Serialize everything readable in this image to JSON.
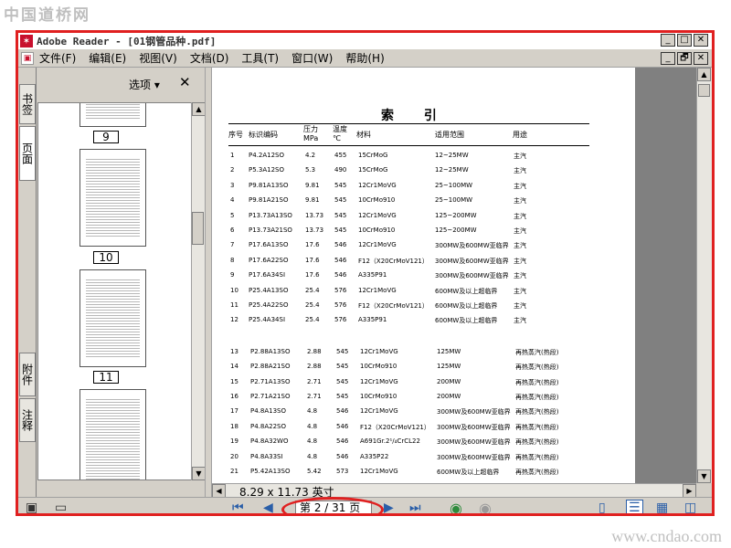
{
  "watermark_top": "中国道桥网",
  "watermark_bottom": "www.cndao.com",
  "window": {
    "title": "Adobe Reader - [01钢管品种.pdf]",
    "min": "_",
    "max": "□",
    "close": "✕",
    "restore": "🗗"
  },
  "menu": [
    "文件(F)",
    "编辑(E)",
    "视图(V)",
    "文档(D)",
    "工具(T)",
    "窗口(W)",
    "帮助(H)"
  ],
  "side_tabs": {
    "bookmarks": "书签",
    "pages": "页面",
    "attachments": "附件",
    "comments": "注释"
  },
  "thumbnails": {
    "options_label": "选项 ▾",
    "close": "✕",
    "labels": [
      "9",
      "10",
      "11"
    ]
  },
  "document": {
    "title": "索 引",
    "headers": {
      "no": "序号",
      "code": "标识编码",
      "pressure": "压力\nMPa",
      "temp": "温度\n℃",
      "material": "材料",
      "range": "适用范围",
      "use": "用途"
    },
    "rows": [
      [
        "1",
        "P4.2A12SO",
        "4.2",
        "455",
        "15CrMoG",
        "12~25MW",
        "主汽"
      ],
      [
        "2",
        "P5.3A12SO",
        "5.3",
        "490",
        "15CrMoG",
        "12~25MW",
        "主汽"
      ],
      [
        "3",
        "P9.81A13SO",
        "9.81",
        "545",
        "12Cr1MoVG",
        "25~100MW",
        "主汽"
      ],
      [
        "4",
        "P9.81A21SO",
        "9.81",
        "545",
        "10CrMo910",
        "25~100MW",
        "主汽"
      ],
      [
        "5",
        "P13.73A13SO",
        "13.73",
        "545",
        "12Cr1MoVG",
        "125~200MW",
        "主汽"
      ],
      [
        "6",
        "P13.73A21SO",
        "13.73",
        "545",
        "10CrMo910",
        "125~200MW",
        "主汽"
      ],
      [
        "7",
        "P17.6A13SO",
        "17.6",
        "546",
        "12Cr1MoVG",
        "300MW及600MW亚临界",
        "主汽"
      ],
      [
        "8",
        "P17.6A22SO",
        "17.6",
        "546",
        "F12（X20CrMoV121）",
        "300MW及600MW亚临界",
        "主汽"
      ],
      [
        "9",
        "P17.6A34SI",
        "17.6",
        "546",
        "A335P91",
        "300MW及600MW亚临界",
        "主汽"
      ],
      [
        "10",
        "P25.4A13SO",
        "25.4",
        "576",
        "12Cr1MoVG",
        "600MW及以上超临界",
        "主汽"
      ],
      [
        "11",
        "P25.4A22SO",
        "25.4",
        "576",
        "F12（X20CrMoV121）",
        "600MW及以上超临界",
        "主汽"
      ],
      [
        "12",
        "P25.4A34SI",
        "25.4",
        "576",
        "A335P91",
        "600MW及以上超临界",
        "主汽"
      ],
      [
        "13",
        "P2.88A13SO",
        "2.88",
        "545",
        "12Cr1MoVG",
        "125MW",
        "再热蒸汽(热段)"
      ],
      [
        "14",
        "P2.88A21SO",
        "2.88",
        "545",
        "10CrMo910",
        "125MW",
        "再热蒸汽(热段)"
      ],
      [
        "15",
        "P2.71A13SO",
        "2.71",
        "545",
        "12Cr1MoVG",
        "200MW",
        "再热蒸汽(热段)"
      ],
      [
        "16",
        "P2.71A21SO",
        "2.71",
        "545",
        "10CrMo910",
        "200MW",
        "再热蒸汽(热段)"
      ],
      [
        "17",
        "P4.8A13SO",
        "4.8",
        "546",
        "12Cr1MoVG",
        "300MW及600MW亚临界",
        "再热蒸汽(热段)"
      ],
      [
        "18",
        "P4.8A22SO",
        "4.8",
        "546",
        "F12（X20CrMoV121）",
        "300MW及600MW亚临界",
        "再热蒸汽(热段)"
      ],
      [
        "19",
        "P4.8A32WO",
        "4.8",
        "546",
        "A691Gr.2¹/₄CrCL22",
        "300MW及600MW亚临界",
        "再热蒸汽(热段)"
      ],
      [
        "20",
        "P4.8A33SI",
        "4.8",
        "546",
        "A335P22",
        "300MW及600MW亚临界",
        "再热蒸汽(热段)"
      ],
      [
        "21",
        "P5.42A13SO",
        "5.42",
        "573",
        "12Cr1MoVG",
        "600MW及以上超临界",
        "再热蒸汽(热段)"
      ]
    ]
  },
  "status": {
    "page_size": "8.29 x 11.73 英寸",
    "page_field": "第 2 / 31 页"
  }
}
